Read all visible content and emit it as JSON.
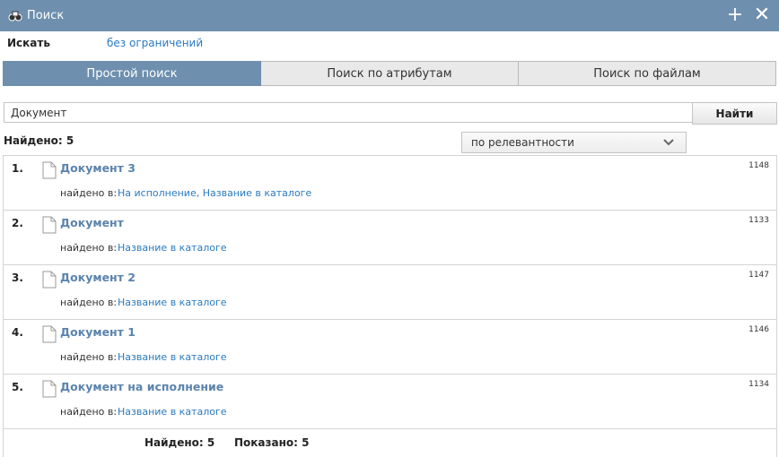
{
  "window": {
    "title": "Поиск",
    "icon": "binoculars-icon",
    "actions": {
      "add": "+",
      "close": "✕"
    }
  },
  "scope": {
    "label": "Искать",
    "value": "без ограничений"
  },
  "tabs": [
    {
      "label": "Простой поиск",
      "active": true
    },
    {
      "label": "Поиск по атрибутам",
      "active": false
    },
    {
      "label": "Поиск по файлам",
      "active": false
    }
  ],
  "search": {
    "value": "Документ",
    "button": "Найти"
  },
  "found_label": "Найдено: 5",
  "sort": {
    "value": "по релевантности"
  },
  "results": [
    {
      "num": "1.",
      "title": "Документ 3",
      "found_in_label": "найдено в:",
      "found_in": "На исполнение, Название в каталоге",
      "id": "1148"
    },
    {
      "num": "2.",
      "title": "Документ",
      "found_in_label": "найдено в:",
      "found_in": "Название в каталоге",
      "id": "1133"
    },
    {
      "num": "3.",
      "title": "Документ 2",
      "found_in_label": "найдено в:",
      "found_in": "Название в каталоге",
      "id": "1147"
    },
    {
      "num": "4.",
      "title": "Документ 1",
      "found_in_label": "найдено в:",
      "found_in": "Название в каталоге",
      "id": "1146"
    },
    {
      "num": "5.",
      "title": "Документ на исполнение",
      "found_in_label": "найдено в:",
      "found_in": "Название в каталоге",
      "id": "1134"
    }
  ],
  "footer": {
    "found": "Найдено: 5",
    "shown": "Показано: 5"
  },
  "colors": {
    "header": "#6f8fae",
    "link": "#2a7ac0",
    "title_link": "#5b83ad"
  }
}
